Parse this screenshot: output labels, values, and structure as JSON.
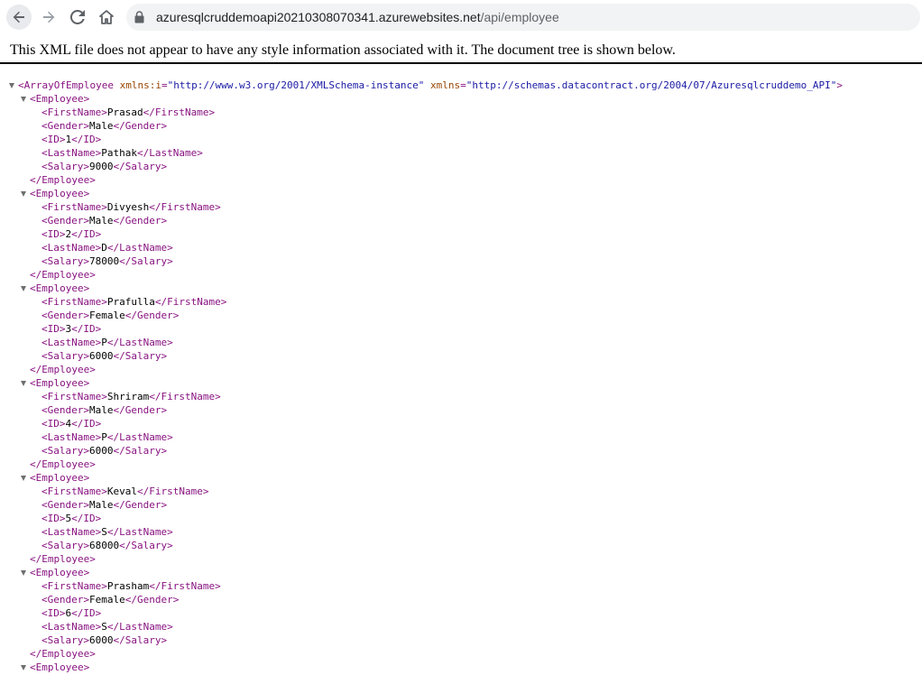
{
  "browser": {
    "url_host": "azuresqlcruddemoapi20210308070341.azurewebsites.net",
    "url_path": "/api/employee"
  },
  "notice": "This XML file does not appear to have any style information associated with it. The document tree is shown below.",
  "root": {
    "tag": "ArrayOfEmployee",
    "attr1_name": "xmlns:i",
    "attr1_value": "\"http://www.w3.org/2001/XMLSchema-instance\"",
    "attr2_name": "xmlns",
    "attr2_value": "\"http://schemas.datacontract.org/2004/07/Azuresqlcruddemo_API\""
  },
  "employees": [
    {
      "FirstName": "Prasad",
      "Gender": "Male",
      "ID": "1",
      "LastName": "Pathak",
      "Salary": "9000"
    },
    {
      "FirstName": "Divyesh",
      "Gender": "Male",
      "ID": "2",
      "LastName": "D",
      "Salary": "78000"
    },
    {
      "FirstName": "Prafulla",
      "Gender": "Female",
      "ID": "3",
      "LastName": "P",
      "Salary": "6000"
    },
    {
      "FirstName": "Shriram",
      "Gender": "Male",
      "ID": "4",
      "LastName": "P",
      "Salary": "6000"
    },
    {
      "FirstName": "Keval",
      "Gender": "Male",
      "ID": "5",
      "LastName": "S",
      "Salary": "68000"
    },
    {
      "FirstName": "Prasham",
      "Gender": "Female",
      "ID": "6",
      "LastName": "S",
      "Salary": "6000"
    }
  ],
  "trailing_open_tag": "<Employee>",
  "colors": {
    "tag": "#881280",
    "attr_name": "#994500",
    "attr_value": "#1a1aa6"
  }
}
